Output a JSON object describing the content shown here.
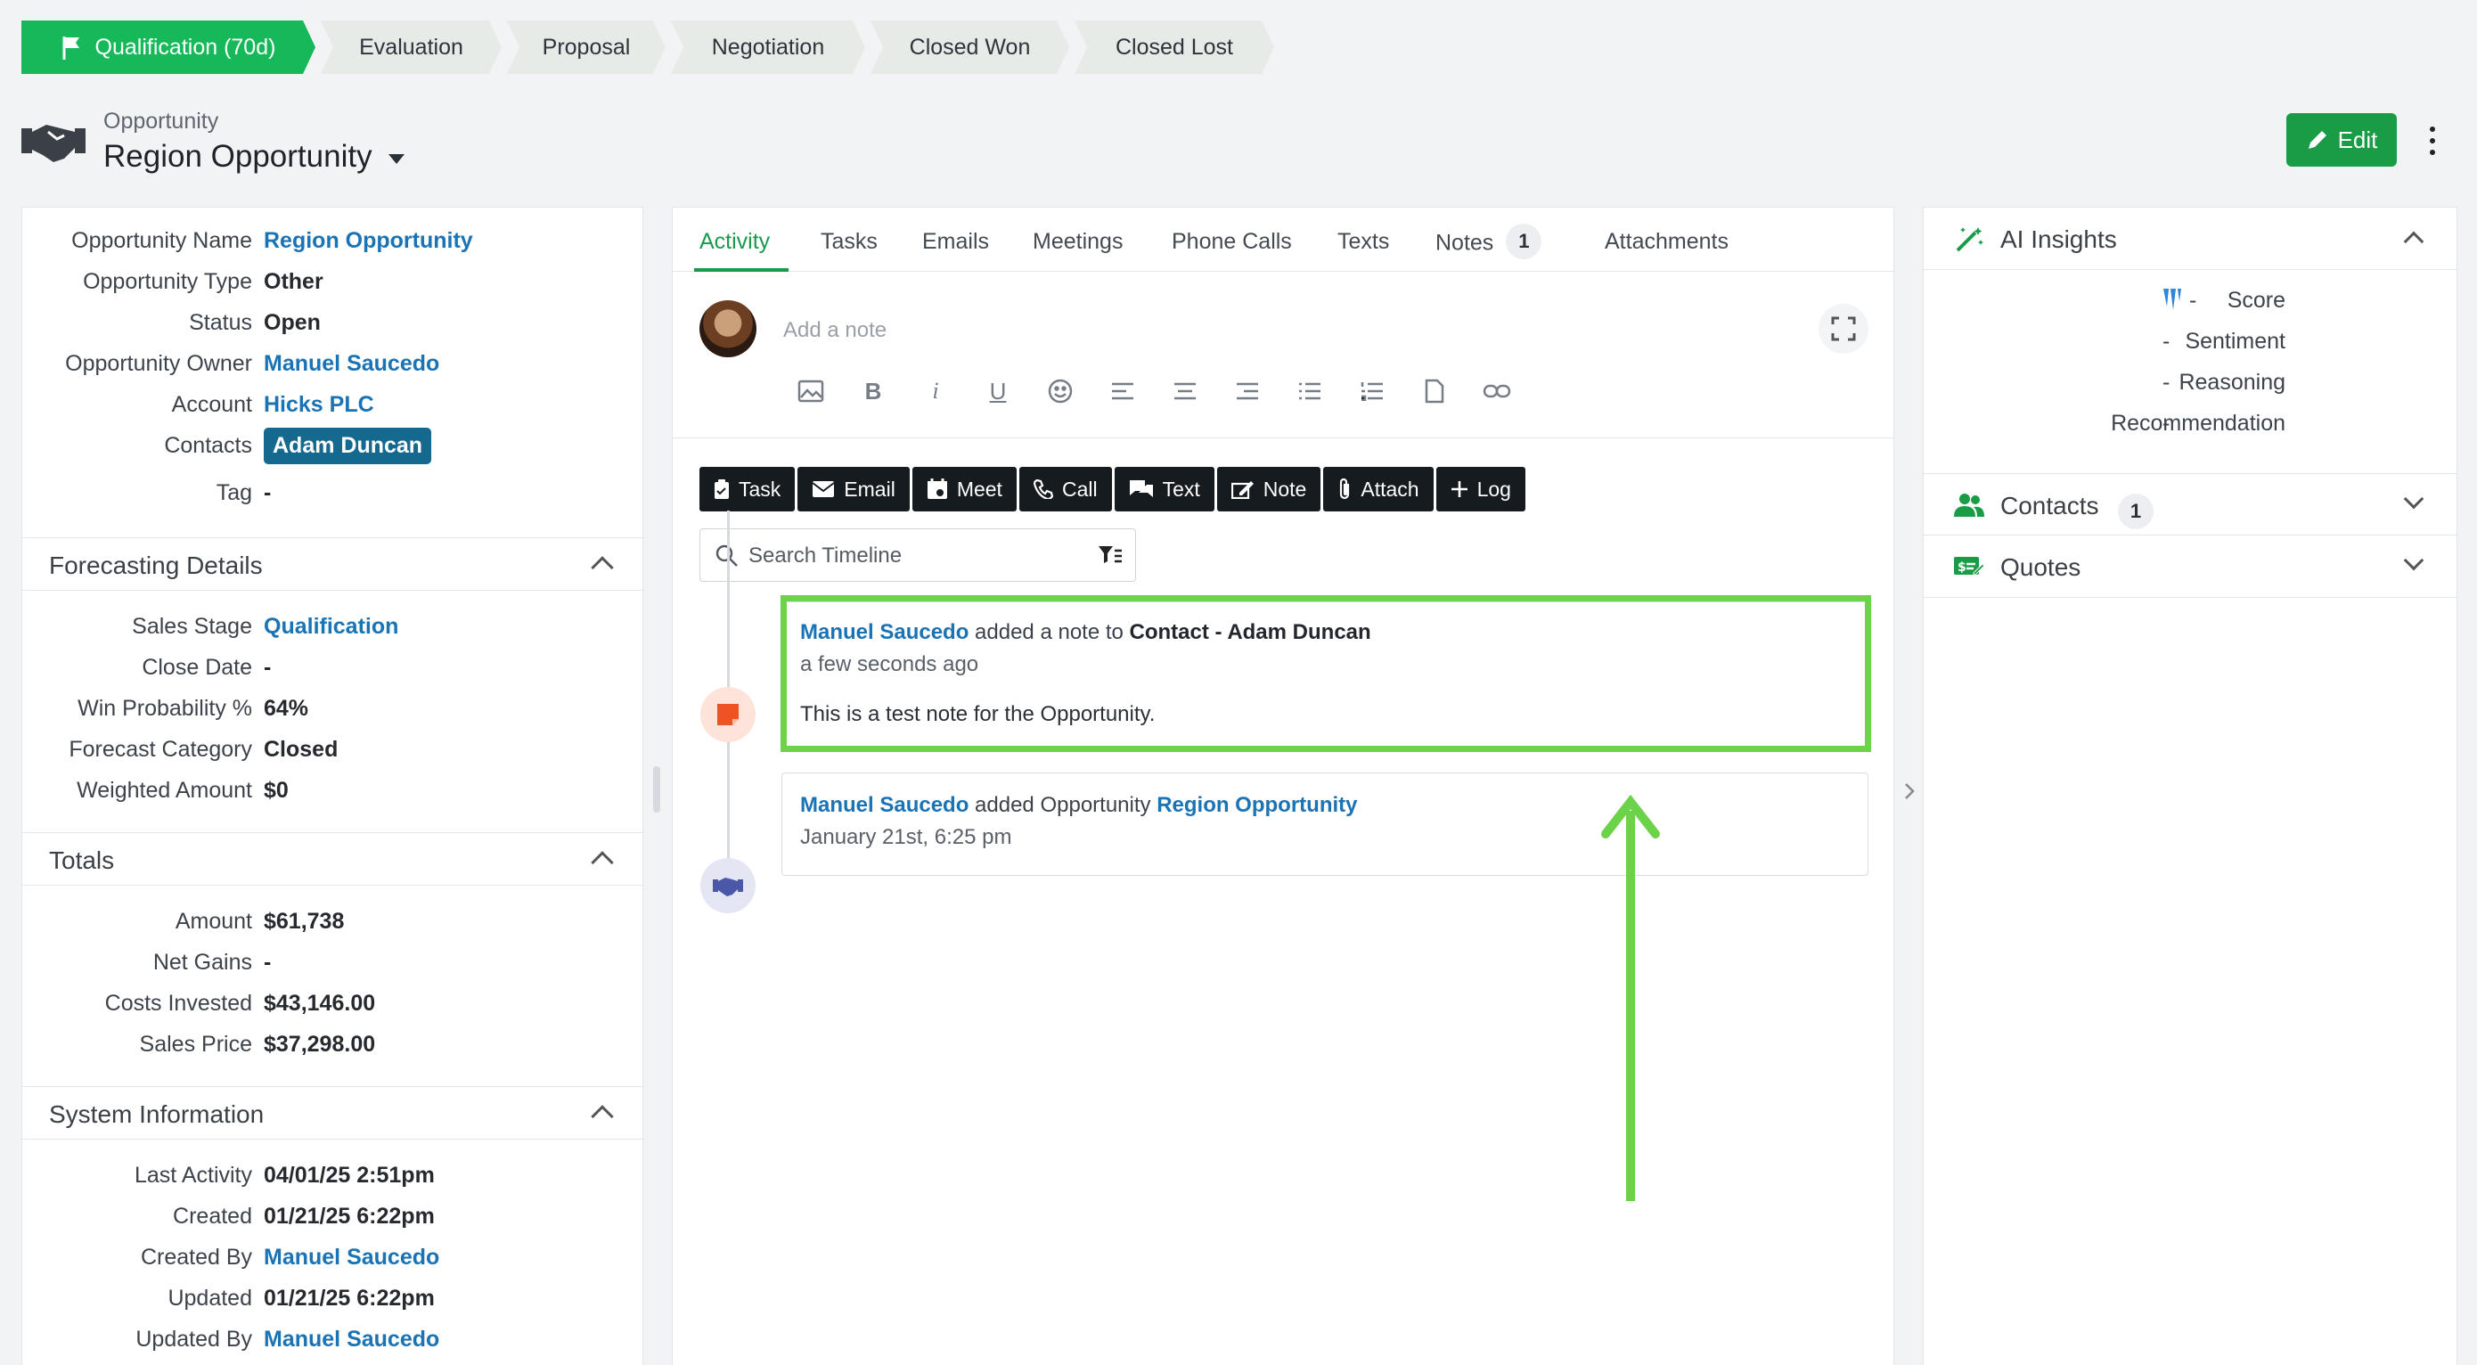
{
  "stages": [
    {
      "label": "Qualification (70d)",
      "active": true
    },
    {
      "label": "Evaluation"
    },
    {
      "label": "Proposal"
    },
    {
      "label": "Negotiation"
    },
    {
      "label": "Closed Won"
    },
    {
      "label": "Closed Lost"
    }
  ],
  "header": {
    "subtitle": "Opportunity",
    "title": "Region Opportunity",
    "edit_label": "Edit",
    "icon": "handshake-icon"
  },
  "details": {
    "rows": [
      {
        "label": "Opportunity Name",
        "value": "Region Opportunity"
      },
      {
        "label": "Opportunity Type",
        "value": "Other"
      },
      {
        "label": "Status",
        "value": "Open"
      },
      {
        "label": "Opportunity Owner",
        "value": "Manuel Saucedo"
      },
      {
        "label": "Account",
        "value": "Hicks PLC"
      },
      {
        "label": "Contacts",
        "value": "Adam Duncan"
      },
      {
        "label": "Tag",
        "value": "-"
      }
    ]
  },
  "forecasting": {
    "title": "Forecasting Details",
    "rows": [
      {
        "label": "Sales Stage",
        "value": "Qualification"
      },
      {
        "label": "Close Date",
        "value": "-"
      },
      {
        "label": "Win Probability %",
        "value": "64%"
      },
      {
        "label": "Forecast Category",
        "value": "Closed"
      },
      {
        "label": "Weighted Amount",
        "value": "$0"
      }
    ]
  },
  "totals": {
    "title": "Totals",
    "rows": [
      {
        "label": "Amount",
        "value": "$61,738"
      },
      {
        "label": "Net Gains",
        "value": "-"
      },
      {
        "label": "Costs Invested",
        "value": "$43,146.00"
      },
      {
        "label": "Sales Price",
        "value": "$37,298.00"
      }
    ]
  },
  "system": {
    "title": "System Information",
    "rows": [
      {
        "label": "Last Activity",
        "value": "04/01/25 2:51pm"
      },
      {
        "label": "Created",
        "value": "01/21/25 6:22pm"
      },
      {
        "label": "Created By",
        "value": "Manuel Saucedo"
      },
      {
        "label": "Updated",
        "value": "01/21/25 6:22pm"
      },
      {
        "label": "Updated By",
        "value": "Manuel Saucedo"
      }
    ]
  },
  "tabs": [
    {
      "label": "Activity",
      "active": true
    },
    {
      "label": "Tasks"
    },
    {
      "label": "Emails"
    },
    {
      "label": "Meetings"
    },
    {
      "label": "Phone Calls"
    },
    {
      "label": "Texts"
    },
    {
      "label": "Notes",
      "count": "1"
    },
    {
      "label": "Attachments"
    }
  ],
  "composer": {
    "placeholder": "Add a note"
  },
  "actions": [
    {
      "label": "Task",
      "icon": "clipboard-icon"
    },
    {
      "label": "Email",
      "icon": "envelope-icon"
    },
    {
      "label": "Meet",
      "icon": "calendar-icon"
    },
    {
      "label": "Call",
      "icon": "phone-icon"
    },
    {
      "label": "Text",
      "icon": "chat-icon"
    },
    {
      "label": "Note",
      "icon": "note-icon"
    },
    {
      "label": "Attach",
      "icon": "paperclip-icon"
    },
    {
      "label": "Log",
      "icon": "plus-icon"
    }
  ],
  "search": {
    "placeholder": "Search Timeline"
  },
  "timeline": [
    {
      "user": "Manuel Saucedo",
      "verb": " added a note to ",
      "target_type": "Contact",
      "sep": " - ",
      "target": "Adam Duncan",
      "time": "a few seconds ago",
      "body": "This is a test note for the Opportunity.",
      "icon_color": "#f05323"
    },
    {
      "user": "Manuel Saucedo",
      "verb": " added Opportunity ",
      "target": "Region Opportunity",
      "time": "January 21st, 6:25 pm",
      "icon_color": "#4b58a8"
    }
  ],
  "insights": {
    "title": "AI Insights",
    "rows": [
      {
        "label": "Score",
        "value": "-"
      },
      {
        "label": "Sentiment",
        "value": "-"
      },
      {
        "label": "Reasoning",
        "value": "-"
      },
      {
        "label": "Recommendation",
        "value": "-"
      }
    ]
  },
  "contacts_section": {
    "title": "Contacts",
    "count": "1"
  },
  "quotes_section": {
    "title": "Quotes"
  },
  "colors": {
    "brand_green": "#1a9b46",
    "link_blue": "#1a73b5",
    "highlight_green": "#6bd24a"
  }
}
